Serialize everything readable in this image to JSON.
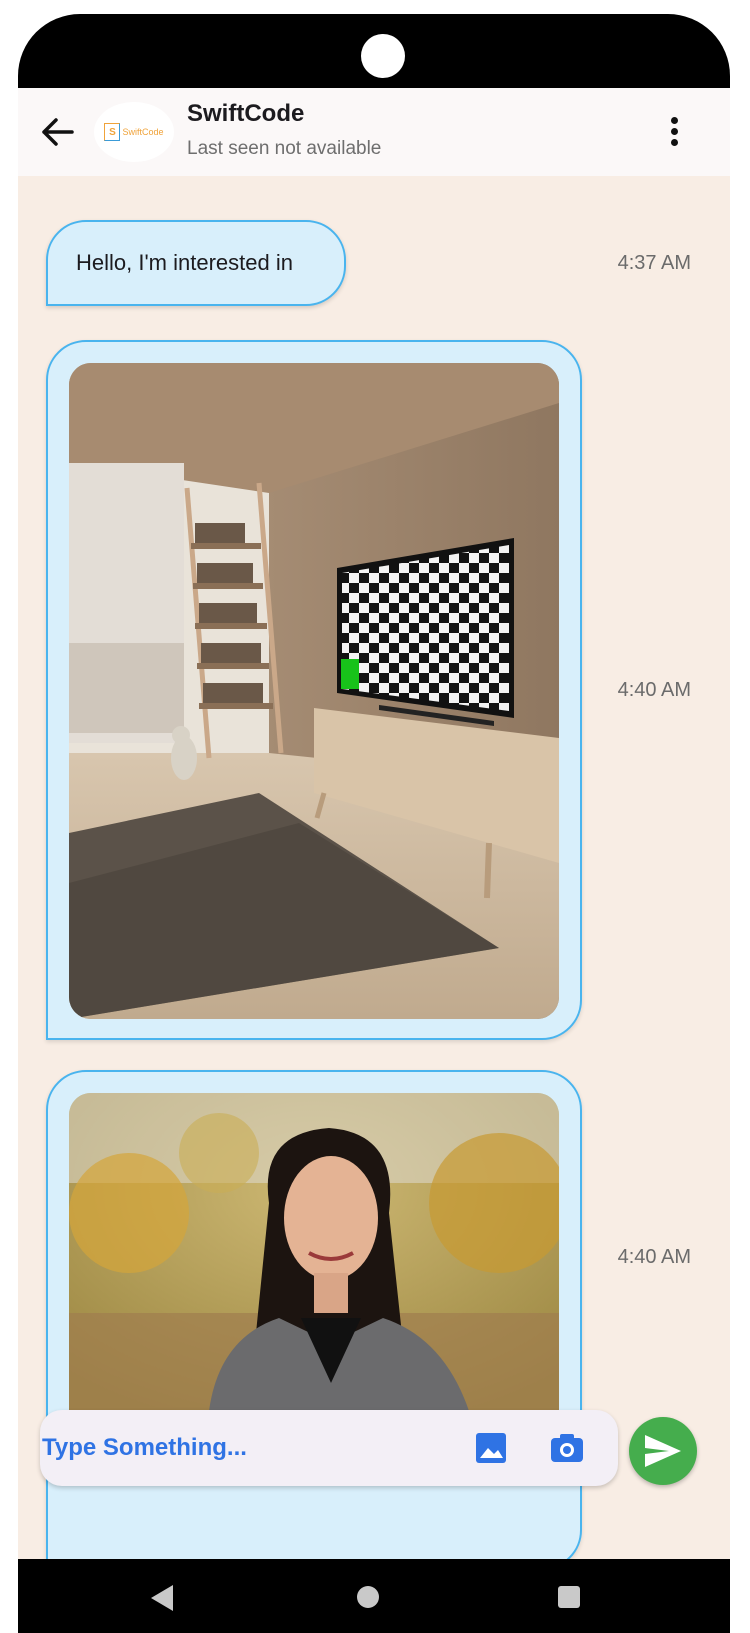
{
  "header": {
    "title": "SwiftCode",
    "subtitle": "Last seen not available",
    "avatar_logo_letter": "S",
    "avatar_logo_text": "SwiftCode",
    "back_icon": "arrow-left-icon",
    "menu_icon": "more-vertical-icon"
  },
  "messages": [
    {
      "type": "text",
      "text": "Hello, I'm interested in",
      "time": "4:37 AM"
    },
    {
      "type": "image",
      "image": "living-room-with-tv-photo",
      "time": "4:40 AM"
    },
    {
      "type": "image",
      "image": "woman-portrait-photo",
      "time": "4:40 AM"
    }
  ],
  "composer": {
    "placeholder": "Type Something...",
    "gallery_icon": "image-icon",
    "camera_icon": "camera-icon",
    "send_icon": "send-icon"
  },
  "colors": {
    "chat_background": "#f8ede4",
    "bubble_fill": "#d8effb",
    "bubble_border": "#49b4ee",
    "placeholder_text": "#2f73e4",
    "send_button": "#45ad4d",
    "composer_icons": "#2f73e4"
  },
  "system_nav": [
    "back-triangle-icon",
    "home-circle-icon",
    "recents-square-icon"
  ]
}
